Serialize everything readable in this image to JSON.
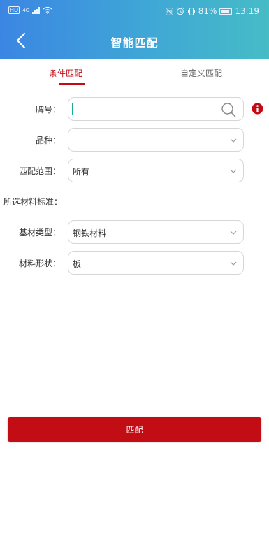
{
  "status_bar": {
    "left_badge": "HD",
    "network": "4G",
    "battery_percent": "81%",
    "time": "13:19"
  },
  "header": {
    "title": "智能匹配"
  },
  "tabs": [
    {
      "label": "条件匹配",
      "active": true
    },
    {
      "label": "自定义匹配",
      "active": false
    }
  ],
  "form": {
    "grade": {
      "label": "牌号：",
      "value": ""
    },
    "variety": {
      "label": "品种：",
      "value": ""
    },
    "match_range": {
      "label": "匹配范围：",
      "value": "所有"
    },
    "selected_standard": {
      "label": "所选材料标准："
    },
    "base_material_type": {
      "label": "基材类型：",
      "value": "钢铁材料"
    },
    "material_shape": {
      "label": "材料形状：",
      "value": "板"
    }
  },
  "actions": {
    "match_label": "匹配"
  },
  "colors": {
    "accent": "#c40a15",
    "header_start": "#3b86e3",
    "header_end": "#46bcc6",
    "caret": "#1aa89a"
  },
  "icons": [
    "back-arrow-icon",
    "search-icon",
    "info-icon",
    "chevron-down-icon",
    "wifi-icon",
    "signal-icon",
    "battery-icon",
    "nfc-icon",
    "alarm-icon",
    "vibrate-icon"
  ]
}
